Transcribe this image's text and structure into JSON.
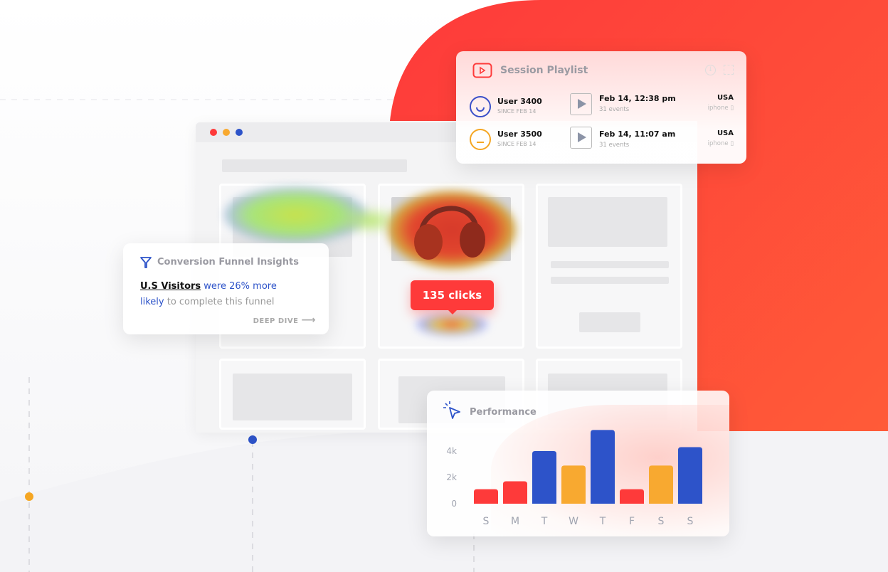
{
  "session_playlist": {
    "title": "Session Playlist",
    "icons": [
      "play-video-icon",
      "download-icon",
      "expand-icon"
    ],
    "sessions": [
      {
        "user": "User 3400",
        "since": "SINCE FEB 14",
        "date": "Feb 14, 12:38 pm",
        "events": "31 events",
        "country": "USA",
        "device": "iphone",
        "mood": "happy",
        "mood_color": "#3a4fc9"
      },
      {
        "user": "User 3500",
        "since": "SINCE FEB 14",
        "date": "Feb 14, 11:07 am",
        "events": "31 events",
        "country": "USA",
        "device": "iphone",
        "mood": "neutral",
        "mood_color": "#f5a623"
      }
    ]
  },
  "heatmap": {
    "clicks_label": "135 clicks"
  },
  "funnel": {
    "title": "Conversion Funnel Insights",
    "highlight": "U.S Visitors",
    "text_blue_1": " were 26% more",
    "text_blue_2": "likely",
    "text_rest": " to complete this funnel",
    "cta": "DEEP DIVE"
  },
  "colors": {
    "accent_red": "#fe3a3a",
    "blue": "#2d53c9",
    "orange": "#f8a930"
  },
  "chart_data": {
    "type": "bar",
    "title": "Performance",
    "categories": [
      "S",
      "M",
      "T",
      "W",
      "T",
      "F",
      "S",
      "S"
    ],
    "values": [
      1100,
      1700,
      4000,
      2900,
      5600,
      1100,
      2900,
      4300
    ],
    "colors": [
      "#fe3a3a",
      "#fe3a3a",
      "#2d53c9",
      "#f8a930",
      "#2d53c9",
      "#fe3a3a",
      "#f8a930",
      "#2d53c9"
    ],
    "yticks": [
      "0",
      "2k",
      "4k"
    ],
    "ytick_values": [
      0,
      2000,
      4000
    ],
    "ylim": [
      0,
      6000
    ],
    "grid": false
  }
}
